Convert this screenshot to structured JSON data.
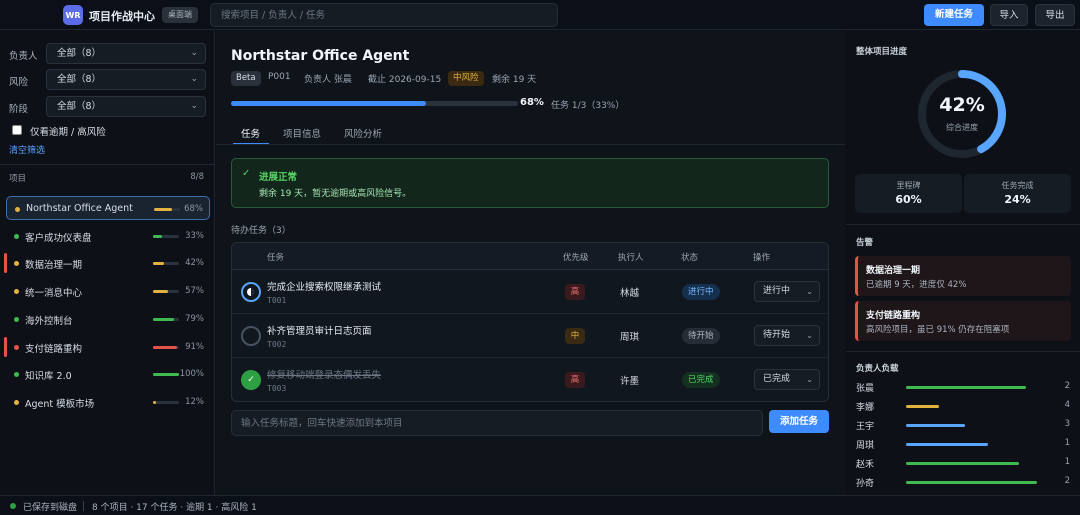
{
  "app": {
    "logo_text": "WR",
    "title": "项目作战中心",
    "mode_badge": "桌面端",
    "search_placeholder": "搜索项目 / 负责人 / 任务",
    "new_task_label": "新建任务",
    "import_label": "导入",
    "export_label": "导出"
  },
  "filters": {
    "owner_label": "负责人",
    "owner_value": "全部（8）",
    "risk_label": "风险",
    "risk_value": "全部（8）",
    "stage_label": "阶段",
    "stage_value": "全部（8）",
    "overdue_only_label": "仅看逾期 / 高风险",
    "overdue_only_checked": false,
    "clear_label": "清空筛选"
  },
  "projects": {
    "header": "项目",
    "count": "8/8",
    "items": [
      {
        "name": "Northstar Office Agent",
        "progress": 68,
        "pct_label": "68%",
        "color": "#e3b341",
        "active": true,
        "alert": false
      },
      {
        "name": "客户成功仪表盘",
        "progress": 33,
        "pct_label": "33%",
        "color": "#3fb950",
        "active": false,
        "alert": false
      },
      {
        "name": "数据治理一期",
        "progress": 42,
        "pct_label": "42%",
        "color": "#e3b341",
        "active": false,
        "alert": true
      },
      {
        "name": "统一消息中心",
        "progress": 57,
        "pct_label": "57%",
        "color": "#e3b341",
        "active": false,
        "alert": false
      },
      {
        "name": "海外控制台",
        "progress": 79,
        "pct_label": "79%",
        "color": "#3fb950",
        "active": false,
        "alert": false
      },
      {
        "name": "支付链路重构",
        "progress": 91,
        "pct_label": "91%",
        "color": "#e5534b",
        "active": false,
        "alert": true
      },
      {
        "name": "知识库 2.0",
        "progress": 100,
        "pct_label": "100%",
        "color": "#3fb950",
        "active": false,
        "alert": false
      },
      {
        "name": "Agent 模板市场",
        "progress": 12,
        "pct_label": "12%",
        "color": "#e3b341",
        "active": false,
        "alert": false
      }
    ]
  },
  "detail": {
    "title": "Northstar Office Agent",
    "stage_badge": "Beta",
    "code": "P001",
    "owner": "负责人 张晨",
    "due": "截止 2026-09-15",
    "risk_badge": "中风险",
    "remaining": "剩余 19 天",
    "progress": 68,
    "progress_label": "68%",
    "tasks_summary": "任务 1/3（33%）",
    "tabs": [
      "任务",
      "项目信息",
      "风险分析"
    ],
    "status_title": "进展正常",
    "status_sub": "剩余 19 天，暂无逾期或高风险信号。",
    "todo_header": "待办任务（3）",
    "columns": [
      "任务",
      "优先级",
      "执行人",
      "状态",
      "操作"
    ],
    "tasks": [
      {
        "title": "完成企业搜索权限继承测试",
        "id": "T001",
        "priority": "高",
        "assignee": "林越",
        "status": "进行中",
        "action": "进行中",
        "state": "inprog"
      },
      {
        "title": "补齐管理员审计日志页面",
        "id": "T002",
        "priority": "中",
        "assignee": "周琪",
        "status": "待开始",
        "action": "待开始",
        "state": "wait"
      },
      {
        "title": "修复移动端登录态偶发丢失",
        "id": "T003",
        "priority": "高",
        "assignee": "许墨",
        "status": "已完成",
        "action": "已完成",
        "state": "done"
      }
    ],
    "add_placeholder": "输入任务标题，回车快速添加到本项目",
    "add_label": "添加任务"
  },
  "overview": {
    "header": "整体项目进度",
    "progress": 42,
    "progress_label": "42%",
    "progress_sub": "综合进度",
    "milestone_label": "里程碑",
    "milestone_value": "60%",
    "task_done_label": "任务完成",
    "task_done_value": "24%"
  },
  "alerts": {
    "header": "告警",
    "items": [
      {
        "title": "数据治理一期",
        "sub": "已逾期 9 天，进度仅 42%"
      },
      {
        "title": "支付链路重构",
        "sub": "高风险项目，虽已 91% 仍存在阻塞项"
      }
    ]
  },
  "workload": {
    "header": "负责人负载",
    "rows": [
      {
        "name": "张晨",
        "count": "2",
        "load": 0.73,
        "color": "#3fb950"
      },
      {
        "name": "李娜",
        "count": "4",
        "load": 0.2,
        "color": "#e3b341"
      },
      {
        "name": "王宇",
        "count": "3",
        "load": 0.36,
        "color": "#58a6ff"
      },
      {
        "name": "周琪",
        "count": "1",
        "load": 0.5,
        "color": "#58a6ff"
      },
      {
        "name": "赵禾",
        "count": "1",
        "load": 0.69,
        "color": "#3fb950"
      },
      {
        "name": "孙奇",
        "count": "2",
        "load": 0.8,
        "color": "#3fb950"
      }
    ]
  },
  "footer": {
    "saved": "已保存到磁盘",
    "summary": "8 个项目 · 17 个任务 · 逾期 1 · 高风险 1"
  }
}
